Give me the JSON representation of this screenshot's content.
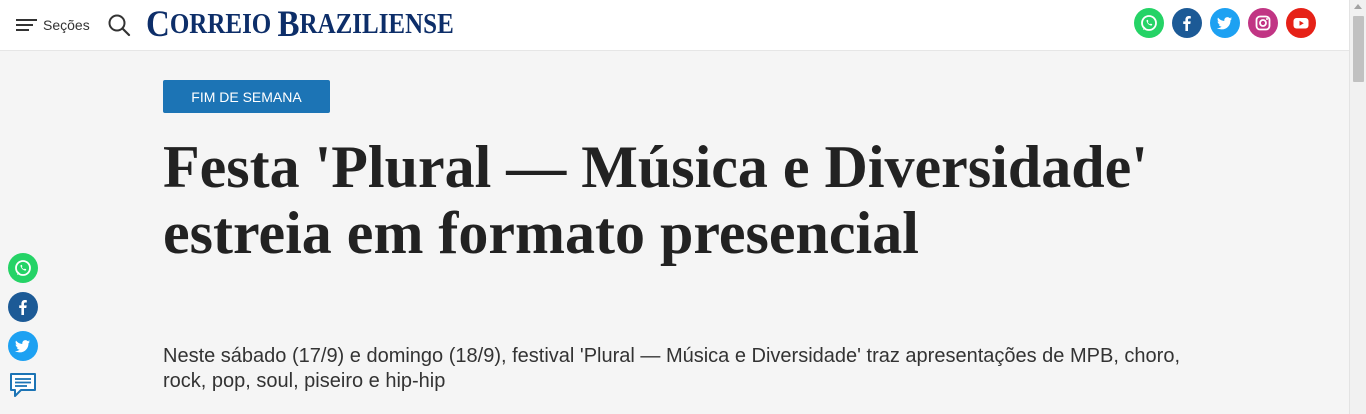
{
  "header": {
    "menu_label": "Seções",
    "logo_first": "C",
    "logo_first_rest": "ORREIO",
    "logo_second": "B",
    "logo_second_rest": "RAZILIENSE",
    "social": [
      {
        "name": "whatsapp-icon",
        "color": "#25d366"
      },
      {
        "name": "facebook-icon",
        "color": "#1877f2"
      },
      {
        "name": "twitter-icon",
        "color": "#1da1f2"
      },
      {
        "name": "instagram-icon",
        "color": "#c13584"
      },
      {
        "name": "youtube-icon",
        "color": "#ff0000"
      }
    ]
  },
  "article": {
    "category": "Fim de semana",
    "title": "Festa 'Plural — Música e Diversidade' estreia em formato presencial",
    "subtitle": "Neste sábado (17/9) e domingo (18/9), festival 'Plural — Música e Diversidade' traz apresentações de MPB, choro, rock, pop, soul, piseiro e hip-hip"
  },
  "share": {
    "icons": [
      "whatsapp-icon",
      "facebook-icon",
      "twitter-icon",
      "comment-icon"
    ],
    "colors": {
      "whatsapp": "#25d366",
      "facebook": "#1c5a96",
      "twitter": "#1da1f2",
      "comment": "#1c74b5"
    }
  }
}
